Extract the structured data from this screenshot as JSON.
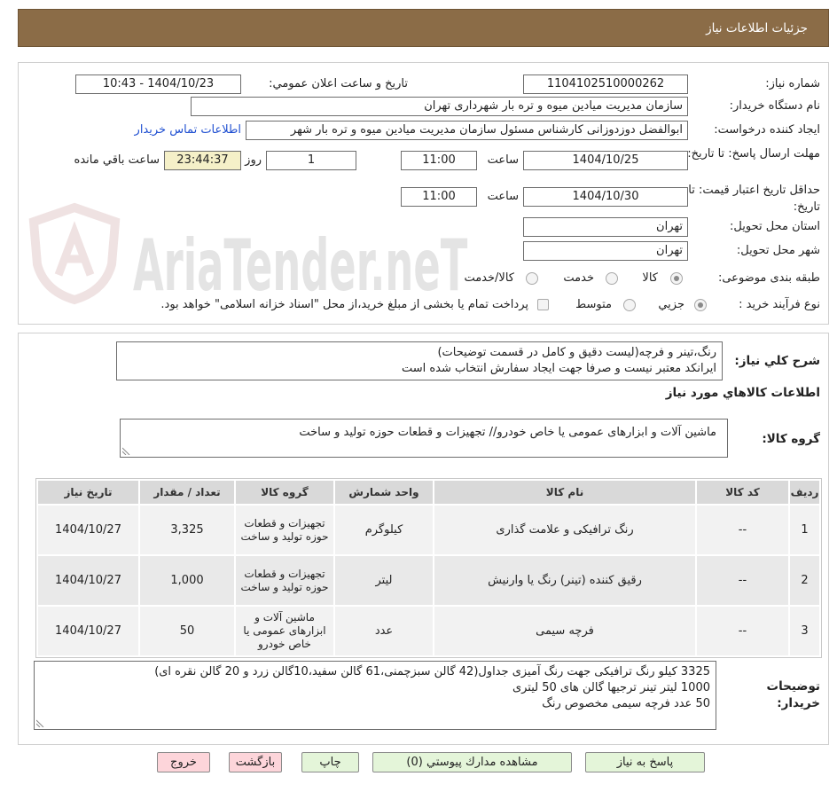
{
  "header": {
    "title": "جزئیات اطلاعات نیاز"
  },
  "watermark": {
    "text": "AriaTender.neT"
  },
  "need": {
    "need_number_label": "شماره نیاز:",
    "need_number": "1104102510000262",
    "announce_label": "تاریخ و ساعت اعلان عمومي:",
    "announce_value": "1404/10/23 - 10:43",
    "buyer_org_label": "نام دستگاه خريدار:",
    "buyer_org": "سازمان مدیریت میادین میوه و تره بار شهرداری تهران",
    "creator_label": "ايجاد کننده درخواست:",
    "creator": "ابوالفضل دوزدوزانی کارشناس مسئول سازمان مدیریت میادین میوه و تره بار شهر",
    "contact_link": "اطلاعات تماس خريدار",
    "deadline_label": "مهلت ارسال پاسخ: تا تاریخ:",
    "deadline_date": "1404/10/25",
    "time_label": "ساعت",
    "deadline_time": "11:00",
    "days_left": "1",
    "days_and_label": "روز و",
    "time_left": "23:44:37",
    "time_left_label": "ساعت باقي مانده",
    "validity_label": "حداقل تاريخ اعتبار قيمت: تا تاريخ:",
    "validity_date": "1404/10/30",
    "validity_time": "11:00",
    "province_label": "استان محل تحويل:",
    "province": "تهران",
    "city_label": "شهر محل تحويل:",
    "city": "تهران",
    "category_label": "طبقه بندی موضوعی:",
    "category_options": [
      {
        "label": "كالا",
        "selected": true
      },
      {
        "label": "خدمت",
        "selected": false
      },
      {
        "label": "كالا/خدمت",
        "selected": false
      }
    ],
    "process_label": "نوع فرآيند خريد :",
    "process_options": [
      {
        "label": "جزيي",
        "selected": true
      },
      {
        "label": "متوسط",
        "selected": false
      }
    ],
    "treasury": {
      "checked": false,
      "label": "پرداخت تمام يا بخشی از مبلغ خريد،از محل \"اسناد خزانه اسلامی\" خواهد بود."
    }
  },
  "overview": {
    "description_label": "شرح كلي نياز:",
    "description_lines": [
      "رنگ،تینر و فرچه(لیست دقیق و کامل در قسمت توضیحات)",
      "ایرانکد معتبر نیست و صرفا جهت ایجاد سفارش انتخاب شده است"
    ],
    "items_heading": "اطلاعات كالاهاي مورد نياز",
    "goods_group_label": "گروه كالا:",
    "goods_group": "ماشین آلات و ابزارهای عمومی یا خاص خودرو// تجهیزات و قطعات حوزه تولید و ساخت"
  },
  "items": {
    "headers": {
      "row": "رديف",
      "code": "كد كالا",
      "name": "نام كالا",
      "unit": "واحد شمارش",
      "group": "گروه كالا",
      "qty": "تعداد / مقدار",
      "date": "تاريخ نياز"
    },
    "rows": [
      {
        "row": "1",
        "code": "--",
        "name": "رنگ ترافیکی و علامت گذاری",
        "unit": "کیلوگرم",
        "group": "تجهیزات و قطعات حوزه تولید و ساخت",
        "qty": "3,325",
        "date": "1404/10/27"
      },
      {
        "row": "2",
        "code": "--",
        "name": "رقیق کننده (تینر) رنگ یا وارنیش",
        "unit": "لیتر",
        "group": "تجهیزات و قطعات حوزه تولید و ساخت",
        "qty": "1,000",
        "date": "1404/10/27"
      },
      {
        "row": "3",
        "code": "--",
        "name": "فرچه سیمی",
        "unit": "عدد",
        "group": "ماشین آلات و ابزارهای عمومی یا خاص خودرو",
        "qty": "50",
        "date": "1404/10/27"
      }
    ]
  },
  "buyer_notes": {
    "label": "توضیحات خریدار:",
    "lines": [
      "3325 کیلو رنگ ترافیکی جهت رنگ آمیزی جداول(42 گالن سبزچمنی،61 گالن سفید،10گالن زرد و 20 گالن نقره ای)",
      "1000 لیتر تینر ترجیها گالن های 50 لیتری",
      "50 عدد فرچه سیمی مخصوص رنگ"
    ]
  },
  "actions": {
    "reply": "پاسخ به نياز",
    "attachments": "مشاهده مدارك پيوستي (0)",
    "print": "چاپ",
    "back": "بازگشت",
    "exit": "خروج"
  },
  "colors": {
    "header_bg": "#8b6c47",
    "time_left_bg": "#f5f0c8",
    "link": "#1f4fd1",
    "green_button": "#e4f5d9",
    "pink_button": "#fdd5da"
  }
}
